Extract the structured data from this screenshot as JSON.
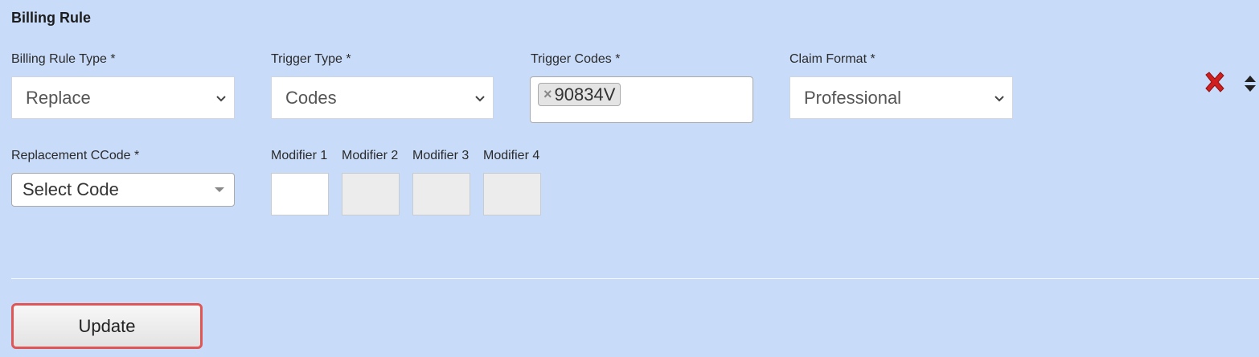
{
  "section": {
    "title": "Billing Rule"
  },
  "fields": {
    "billing_rule_type": {
      "label": "Billing Rule Type *",
      "value": "Replace"
    },
    "trigger_type": {
      "label": "Trigger Type *",
      "value": "Codes"
    },
    "trigger_codes": {
      "label": "Trigger Codes *",
      "tags": [
        "90834V"
      ],
      "remove_glyph": "×"
    },
    "claim_format": {
      "label": "Claim Format *",
      "value": "Professional"
    },
    "replacement_code": {
      "label": "Replacement CCode *",
      "value": "Select Code"
    },
    "modifiers": [
      {
        "label": "Modifier 1",
        "value": "",
        "enabled": true
      },
      {
        "label": "Modifier 2",
        "value": "",
        "enabled": false
      },
      {
        "label": "Modifier 3",
        "value": "",
        "enabled": false
      },
      {
        "label": "Modifier 4",
        "value": "",
        "enabled": false
      }
    ]
  },
  "actions": {
    "update_label": "Update",
    "delete_icon": "red-x-icon",
    "sort_icon": "sort-arrows-icon"
  },
  "colors": {
    "background": "#c8dcfa",
    "delete": "#d01f1f",
    "update_border": "#e05555"
  }
}
